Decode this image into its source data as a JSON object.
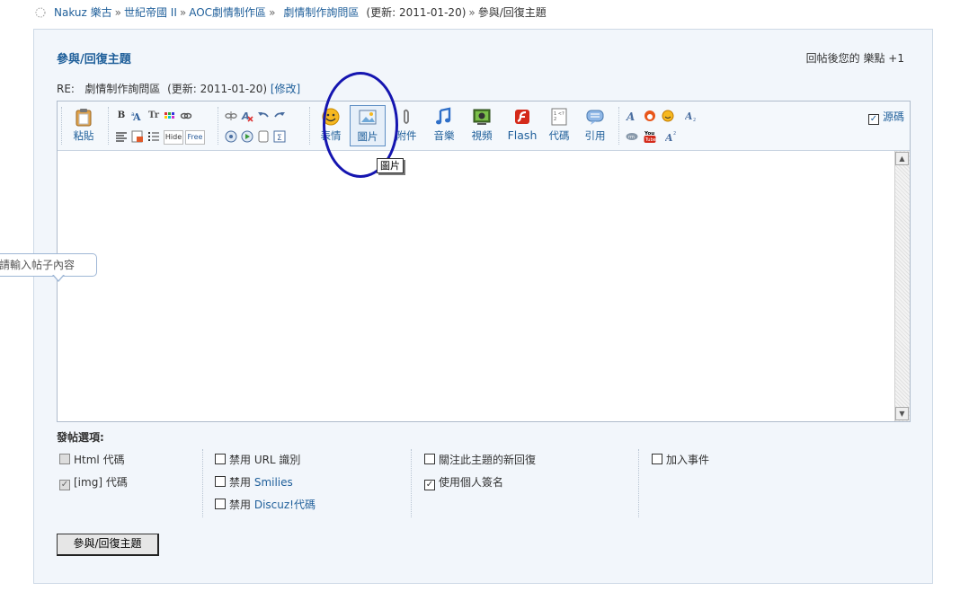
{
  "breadcrumb": {
    "items": [
      "Nakuz 樂古",
      "世紀帝國 II",
      "AOC劇情制作區",
      "劇情制作詢問區"
    ],
    "separator": "»",
    "updated": "(更新: 2011-01-20)",
    "current": "參與/回復主題"
  },
  "panel": {
    "title": "參與/回復主題",
    "credit_label": "回帖後您的 樂點 +1"
  },
  "reply": {
    "prefix": "RE:",
    "subject": "劇情制作詢問區",
    "updated": "(更新: 2011-01-20)",
    "edit_label": "[修改]"
  },
  "toolbar": {
    "paste_label": "粘貼",
    "buttons": [
      {
        "label": "表情",
        "icon": "smiley-icon"
      },
      {
        "label": "圖片",
        "icon": "picture-icon"
      },
      {
        "label": "附件",
        "icon": "paperclip-icon"
      },
      {
        "label": "音樂",
        "icon": "music-note-icon"
      },
      {
        "label": "視頻",
        "icon": "video-icon"
      },
      {
        "label": "Flash",
        "icon": "flash-icon"
      },
      {
        "label": "代碼",
        "icon": "code-icon"
      },
      {
        "label": "引用",
        "icon": "quote-icon"
      }
    ],
    "format_small": [
      "B",
      "Tr",
      "Hide",
      "Free"
    ],
    "source_label": "源碼",
    "tooltip": "圖片"
  },
  "editor": {
    "hint": "請輸入帖子內容"
  },
  "options": {
    "title": "發帖選項:",
    "col1": [
      {
        "label": "Html 代碼",
        "checked": false,
        "disabled": true
      },
      {
        "label": "[img] 代碼",
        "checked": true,
        "disabled": true
      }
    ],
    "col2": [
      {
        "prefix": "禁用 URL 識別",
        "link": ""
      },
      {
        "prefix": "禁用 ",
        "link": "Smilies"
      },
      {
        "prefix": "禁用 ",
        "link": "Discuz!代碼"
      }
    ],
    "col3": [
      {
        "label": "關注此主題的新回復",
        "checked": false
      },
      {
        "label": "使用個人簽名",
        "checked": true
      }
    ],
    "col4": [
      {
        "label": "加入事件",
        "checked": false
      }
    ]
  },
  "submit_label": "參與/回復主題",
  "colors": {
    "accent": "#1f5f9a",
    "panel_bg": "#f2f6fb",
    "annotation_circle": "#1515b0"
  }
}
